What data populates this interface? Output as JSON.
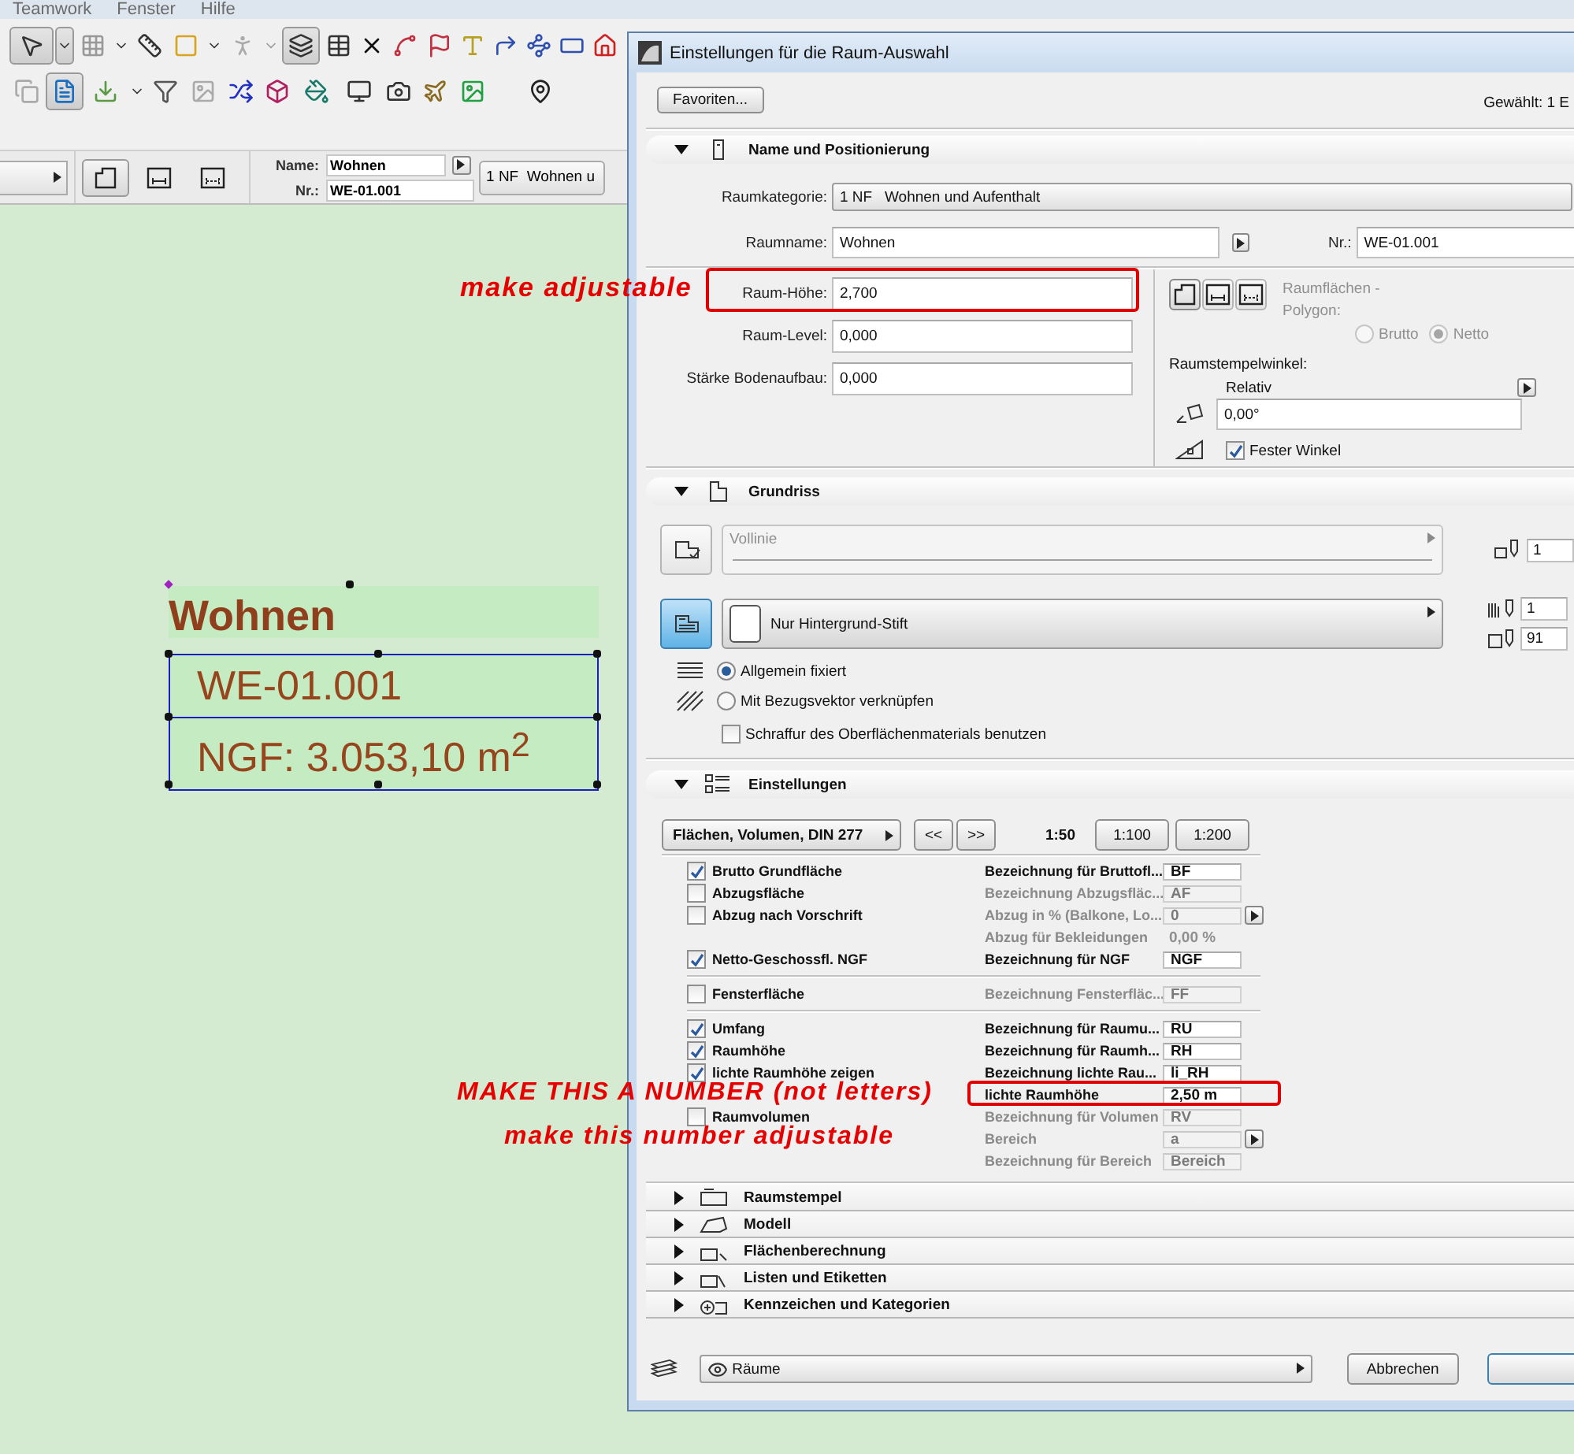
{
  "menu": [
    {
      "label": "Teamwork"
    },
    {
      "label": "Fenster"
    },
    {
      "label": "Hilfe"
    }
  ],
  "toolbars": [
    [
      {
        "selected": true
      },
      {
        "selected": true
      },
      {
        "selected": false
      },
      {
        "selected": false
      },
      {
        "selected": false
      },
      {
        "selected": false
      },
      {
        "selected": false
      },
      {
        "selected": false
      },
      {
        "selected": false
      },
      {
        "selected": true
      },
      {
        "selected": false
      },
      {
        "selected": false
      },
      {
        "selected": false
      },
      {
        "selected": false
      },
      {
        "selected": false
      },
      {
        "selected": false
      },
      {
        "selected": false
      },
      {
        "selected": false
      },
      {
        "selected": false
      }
    ],
    [
      {
        "selected": false
      },
      {
        "selected": true
      },
      {
        "selected": false
      },
      {
        "selected": false
      },
      {
        "selected": false
      },
      {
        "selected": false
      },
      {
        "selected": false
      },
      {
        "selected": false
      },
      {
        "selected": false
      },
      {
        "selected": false
      },
      {
        "selected": false
      },
      {
        "selected": false
      },
      {
        "selected": false
      },
      {
        "selected": false
      }
    ]
  ],
  "info_bar": {
    "polygon_modes": [
      {
        "selected": true
      },
      {
        "selected": false
      },
      {
        "selected": false
      }
    ],
    "fields": [
      {
        "label": "Name:",
        "value": "Wohnen"
      },
      {
        "label": "Nr.:",
        "value": "WE-01.001"
      }
    ],
    "category": "1 NF  Wohnen u"
  },
  "stamp": {
    "name": "Wohnen",
    "number": "WE-01.001",
    "area": "NGF: 3.053,10 m$^{2}$"
  },
  "dialog": {
    "title": "Einstellungen für die Raum-Auswahl",
    "favorites": "Favoriten...",
    "selection": "Gewählt: 1 E",
    "name_section": {
      "title": "Name und Positionierung",
      "expanded": true,
      "category_label": "Raumkategorie:",
      "category": "1 NF   Wohnen und Aufenthalt",
      "name_label": "Raumname:",
      "name": "Wohnen",
      "nr_label": "Nr.:",
      "nr": "WE-01.001",
      "fields": [
        {
          "label": "Raum-Höhe:",
          "value": "2,700"
        },
        {
          "label": "Raum-Level:",
          "value": "0,000"
        },
        {
          "label": "Stärke Bodenaufbau:",
          "value": "0,000"
        }
      ],
      "polygon_modes": [
        {
          "selected": true
        },
        {
          "selected": false
        },
        {
          "selected": false
        }
      ],
      "polygon_label": "Raumflächen - Polygon:",
      "polygon_options": [
        {
          "label": "Brutto",
          "selected": false
        },
        {
          "label": "Netto",
          "selected": true
        }
      ],
      "angle_label": "Raumstempelwinkel:",
      "angle_mode": "Relativ",
      "angle": "0,00°",
      "fixed_angle": {
        "label": "Fester Winkel",
        "checked": true
      }
    },
    "plan_section": {
      "title": "Grundriss",
      "expanded": true,
      "line_selected": false,
      "line_type": "Vollinie",
      "line_pen": "1",
      "fill_selected": true,
      "fill": "Nur Hintergrund-Stift",
      "fill_pen": "1",
      "background_pen": "91",
      "orientation": [
        {
          "label": "Allgemein fixiert",
          "selected": true
        },
        {
          "label": "Mit Bezugsvektor verknüpfen",
          "selected": false
        }
      ],
      "material": {
        "label": "Schraffur des Oberflächenmaterials benutzen",
        "checked": false
      }
    },
    "settings_section": {
      "title": "Einstellungen",
      "expanded": true,
      "preset": "Flächen, Volumen, DIN 277",
      "nav": [
        "<<",
        ">>"
      ],
      "scales": [
        {
          "label": "1:50",
          "selected": true
        },
        {
          "label": "1:100",
          "selected": false
        },
        {
          "label": "1:200",
          "selected": false
        }
      ],
      "groups": [
        [
          {
            "option": {
              "label": "Brutto Grundfläche",
              "checked": true
            },
            "property": {
              "kind": "field",
              "label": "Bezeichnung für Bruttofl...",
              "value": "BF",
              "disabled": false
            }
          },
          {
            "option": {
              "label": "Abzugsfläche",
              "checked": false
            },
            "property": {
              "kind": "field",
              "label": "Bezeichnung Abzugsfläc...",
              "value": "AF",
              "disabled": true
            }
          },
          {
            "option": {
              "label": "Abzug nach Vorschrift",
              "checked": false
            },
            "property": {
              "kind": "picker",
              "label": "Abzug in % (Balkone, Lo...",
              "value": "0",
              "disabled": true
            }
          },
          {
            "property": {
              "kind": "reading",
              "label": "Abzug für Bekleidungen",
              "value": "0,00 %",
              "disabled": true
            }
          },
          {
            "option": {
              "label": "Netto-Geschossfl. NGF",
              "checked": true
            },
            "property": {
              "kind": "field",
              "label": "Bezeichnung für NGF",
              "value": "NGF",
              "disabled": false
            }
          }
        ],
        [
          {
            "option": {
              "label": "Fensterfläche",
              "checked": false
            },
            "property": {
              "kind": "field",
              "label": "Bezeichnung Fensterfläc...",
              "value": "FF",
              "disabled": true
            }
          }
        ],
        [
          {
            "option": {
              "label": "Umfang",
              "checked": true
            },
            "property": {
              "kind": "field",
              "label": "Bezeichnung für Raumu...",
              "value": "RU",
              "disabled": false
            }
          },
          {
            "option": {
              "label": "Raumhöhe",
              "checked": true
            },
            "property": {
              "kind": "field",
              "label": "Bezeichnung für Raumh...",
              "value": "RH",
              "disabled": false
            }
          },
          {
            "option": {
              "label": "lichte Raumhöhe zeigen",
              "checked": true
            },
            "property": {
              "kind": "field",
              "label": "Bezeichnung lichte Rau...",
              "value": "li_RH",
              "disabled": false
            }
          },
          {
            "property": {
              "kind": "field",
              "label": "lichte Raumhöhe",
              "value": "2,50 m",
              "disabled": false
            }
          },
          {
            "option": {
              "label": "Raumvolumen",
              "checked": false
            },
            "property": {
              "kind": "field",
              "label": "Bezeichnung für Volumen",
              "value": "RV",
              "disabled": true
            }
          },
          {
            "property": {
              "kind": "picker",
              "label": "Bereich",
              "value": "a",
              "disabled": true
            }
          },
          {
            "property": {
              "kind": "field",
              "label": "Bezeichnung für Bereich",
              "value": "Bereich",
              "disabled": true
            }
          }
        ]
      ]
    },
    "more_sections": [
      {
        "title": "Raumstempel",
        "expanded": false
      },
      {
        "title": "Modell",
        "expanded": false
      },
      {
        "title": "Flächenberechnung",
        "expanded": false
      },
      {
        "title": "Listen und Etiketten",
        "expanded": false
      },
      {
        "title": "Kennzeichen und Kategorien",
        "expanded": false
      }
    ],
    "layer": "Räume",
    "cancel": "Abbrechen"
  },
  "annotations": [
    {
      "kind": "note",
      "text": "make adjustable"
    },
    {
      "kind": "frame"
    },
    {
      "kind": "note",
      "text": "MAKE THIS A NUMBER (not letters)"
    },
    {
      "kind": "note",
      "text": "make this number adjustable"
    },
    {
      "kind": "frame"
    }
  ]
}
